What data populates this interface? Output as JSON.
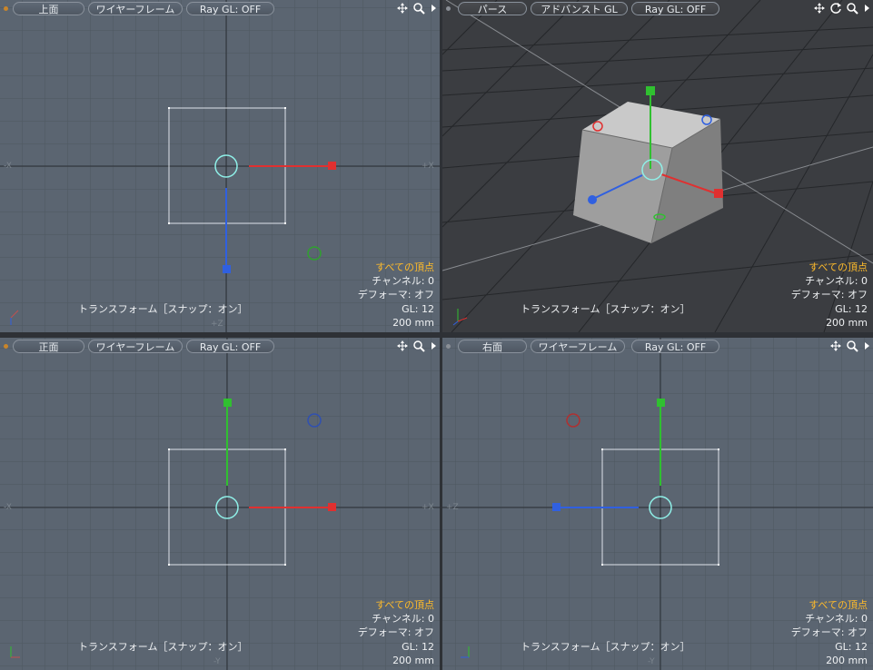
{
  "viewports": {
    "top": {
      "view": "上面",
      "shading": "ワイヤーフレーム",
      "raygl": "Ray GL: OFF",
      "mode": "トランスフォーム［スナップ：オン］",
      "axes": {
        "neg": "-X",
        "pos": "+X",
        "bottom": "+Z"
      }
    },
    "persp": {
      "view": "パース",
      "shading": "アドバンスト GL",
      "raygl": "Ray GL: OFF",
      "mode": "トランスフォーム［スナップ：オン］"
    },
    "front": {
      "view": "正面",
      "shading": "ワイヤーフレーム",
      "raygl": "Ray GL: OFF",
      "mode": "トランスフォーム［スナップ：オン］",
      "axes": {
        "neg": "-X",
        "pos": "+X",
        "bottom": "-Y"
      }
    },
    "right": {
      "view": "右面",
      "shading": "ワイヤーフレーム",
      "raygl": "Ray GL: OFF",
      "mode": "トランスフォーム［スナップ：オン］",
      "axes": {
        "neg": "+Z",
        "bottom": "-Y"
      }
    }
  },
  "info": {
    "selection": "すべての頂点",
    "channel": "チャンネル: 0",
    "deformer": "デフォーマ: オフ",
    "gl": "GL: 12",
    "scale": "200 mm"
  },
  "icons": {
    "move": "move-view-icon",
    "zoom": "zoom-view-icon",
    "rotate": "rotate-view-icon",
    "menu": "viewport-menu-arrow-icon"
  },
  "colors": {
    "x": "#e03030",
    "y": "#30c030",
    "z": "#3060e0",
    "highlight": "#ffbb2a",
    "background": "#5b6571"
  }
}
